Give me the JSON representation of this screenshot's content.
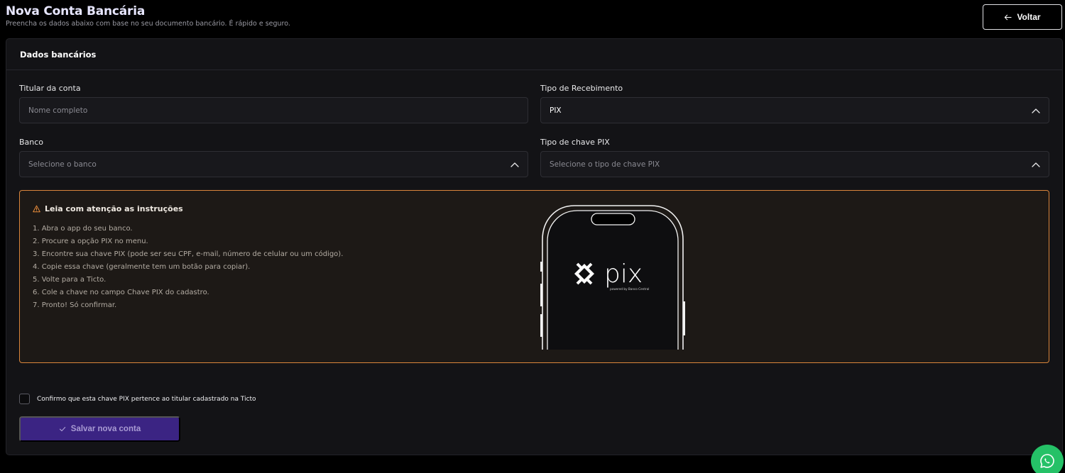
{
  "header": {
    "title": "Nova Conta Bancária",
    "subtitle": "Preencha os dados abaixo com base no seu documento bancário. É rápido e seguro.",
    "back_label": "Voltar"
  },
  "form": {
    "section_title": "Dados bancários",
    "holder": {
      "label": "Titular da conta",
      "placeholder": "Nome completo"
    },
    "receipt_type": {
      "label": "Tipo de Recebimento",
      "value": "PIX"
    },
    "bank": {
      "label": "Banco",
      "placeholder": "Selecione o banco"
    },
    "pix_key_type": {
      "label": "Tipo de chave PIX",
      "placeholder": "Selecione o tipo de chave PIX"
    }
  },
  "instructions": {
    "title": "Leia com atenção as instruções",
    "steps": [
      "1. Abra o app do seu banco.",
      "2. Procure a opção PIX no menu.",
      "3. Encontre sua chave PIX (pode ser seu CPF, e-mail, número de celular ou um código).",
      "4. Copie essa chave (geralmente tem um botão para copiar).",
      "5. Volte para a Ticto.",
      "6. Cole a chave no campo Chave PIX do cadastro.",
      "7. Pronto! Só confirmar."
    ],
    "phone_logo_text": "pix",
    "phone_logo_caption": "powered by Banco Central"
  },
  "confirm": {
    "label": "Confirmo que esta chave PIX pertence ao titular cadastrado na Ticto"
  },
  "actions": {
    "save_label": "Salvar nova conta"
  },
  "colors": {
    "accent_warning": "#d9853b",
    "save_button": "#3b2483",
    "whatsapp": "#25c167"
  },
  "icons": {
    "back": "arrow-left-icon",
    "chevron": "chevron-up-icon",
    "warning": "warning-triangle-icon",
    "save": "check-icon",
    "whatsapp": "whatsapp-icon"
  }
}
